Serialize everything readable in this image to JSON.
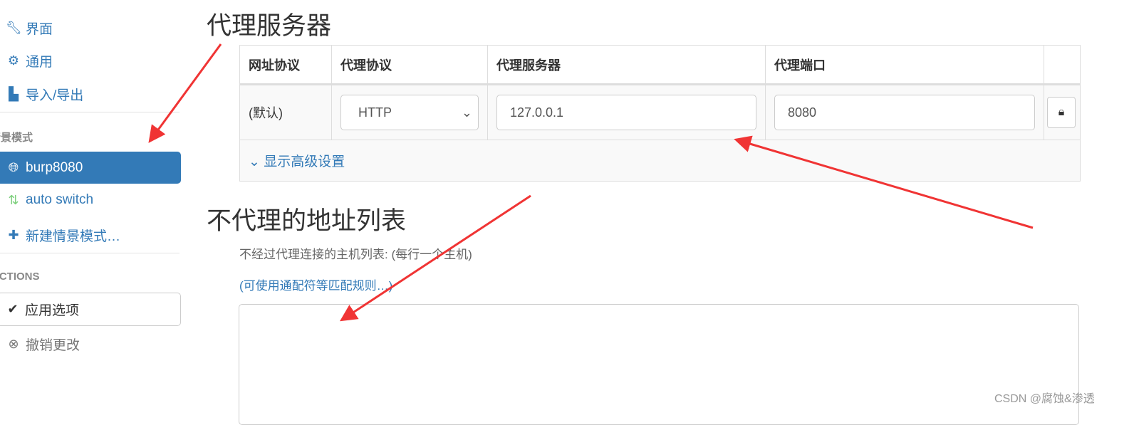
{
  "sidebar": {
    "settings": [
      {
        "label": "界面",
        "icon": "wrench-icon"
      },
      {
        "label": "通用",
        "icon": "gear-icon"
      },
      {
        "label": "导入/导出",
        "icon": "save-icon"
      }
    ],
    "profiles_header": "情景模式",
    "profiles": [
      {
        "label": "burp8080",
        "icon": "globe-icon",
        "active": true
      },
      {
        "label": "auto switch",
        "icon": "retweet-icon"
      },
      {
        "label": "新建情景模式…",
        "icon": "plus-icon"
      }
    ],
    "actions_header": "ACTIONS",
    "apply": "应用选项",
    "discard": "撤销更改"
  },
  "proxy": {
    "title": "代理服务器",
    "headers": [
      "网址协议",
      "代理协议",
      "代理服务器",
      "代理端口"
    ],
    "scheme": "(默认)",
    "protocol": "HTTP",
    "server": "127.0.0.1",
    "port": "8080",
    "advanced": "显示高级设置"
  },
  "bypass": {
    "title": "不代理的地址列表",
    "description": "不经过代理连接的主机列表: (每行一个主机)",
    "wildcard_link": "(可使用通配符等匹配规则…)",
    "value": ""
  },
  "watermark": "CSDN @腐蚀&渗透",
  "colors": {
    "accent": "#337ab7",
    "arrow": "#f03434"
  }
}
